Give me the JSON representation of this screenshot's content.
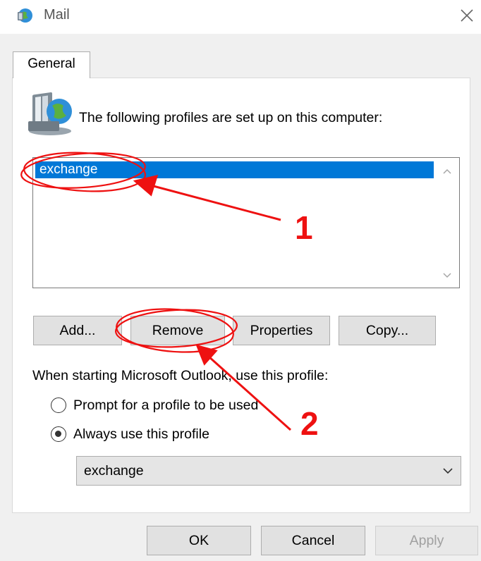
{
  "window": {
    "title": "Mail",
    "icon": "mail-globe-icon"
  },
  "tabs": [
    {
      "label": "General",
      "selected": true
    }
  ],
  "profiles": {
    "label": "The following profiles are set up on this computer:",
    "icon": "profiles-icon",
    "items": [
      {
        "name": "exchange",
        "selected": true
      }
    ]
  },
  "buttons": {
    "add": "Add...",
    "remove": "Remove",
    "properties": "Properties",
    "copy": "Copy..."
  },
  "startup": {
    "label": "When starting Microsoft Outlook, use this profile:",
    "options": [
      {
        "label": "Prompt for a profile to be used",
        "selected": false
      },
      {
        "label": "Always use this profile",
        "selected": true
      }
    ],
    "selected_profile": "exchange"
  },
  "dialog_buttons": {
    "ok": "OK",
    "cancel": "Cancel",
    "apply": "Apply",
    "apply_enabled": false
  },
  "annotations": {
    "color": "#ee1111",
    "callouts": [
      {
        "label": "1"
      },
      {
        "label": "2"
      }
    ]
  },
  "colors": {
    "selection": "#0078d7",
    "annotation": "#ee1111"
  }
}
